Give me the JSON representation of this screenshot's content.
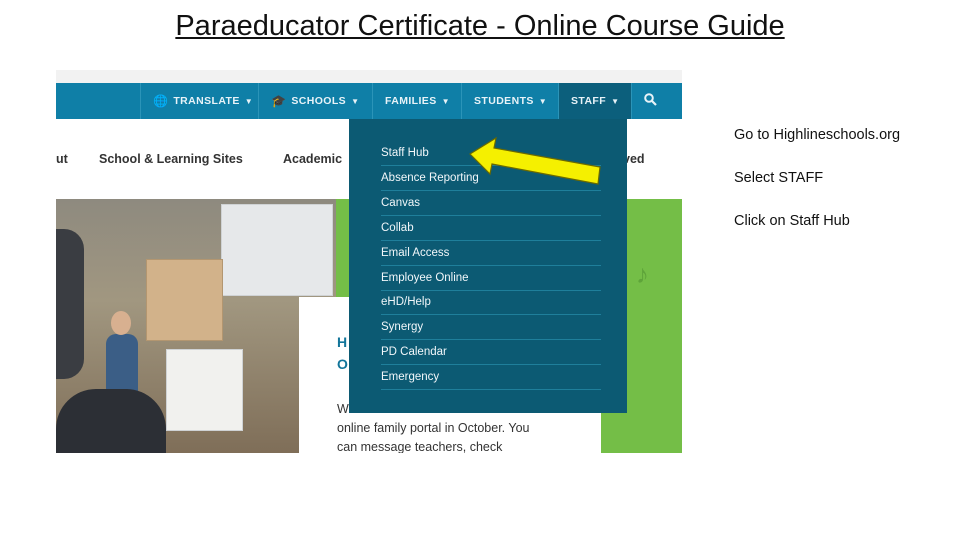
{
  "slide": {
    "title": "Paraeducator Certificate -  Online Course Guide"
  },
  "navbar": {
    "items": [
      {
        "label": "TRANSLATE",
        "icon": "globe-icon"
      },
      {
        "label": "SCHOOLS",
        "icon": "graduation-cap-icon"
      },
      {
        "label": "FAMILIES"
      },
      {
        "label": "STUDENTS"
      },
      {
        "label": "STAFF"
      }
    ],
    "search_icon": "search-icon",
    "color": "#0f7fa7"
  },
  "subnav": {
    "items": [
      "ut",
      "School & Learning Sites",
      "Academic",
      "ved"
    ]
  },
  "dropdown": {
    "items": [
      "Staff Hub",
      "Absence Reporting",
      "Canvas",
      "Collab",
      "Email Access",
      "Employee Online",
      "eHD/Help",
      "Synergy",
      "PD Calendar",
      "Emergency"
    ],
    "color": "#0c5a73"
  },
  "card": {
    "heading_line1": "H",
    "heading_line2": "O",
    "body_line1": "W",
    "body_line2": "online family portal in October. You",
    "body_line3": "can message teachers, check"
  },
  "arrow": {
    "color": "#f5f000"
  },
  "instructions": [
    "Go to Highlineschools.org",
    "Select STAFF",
    "Click on Staff Hub"
  ]
}
